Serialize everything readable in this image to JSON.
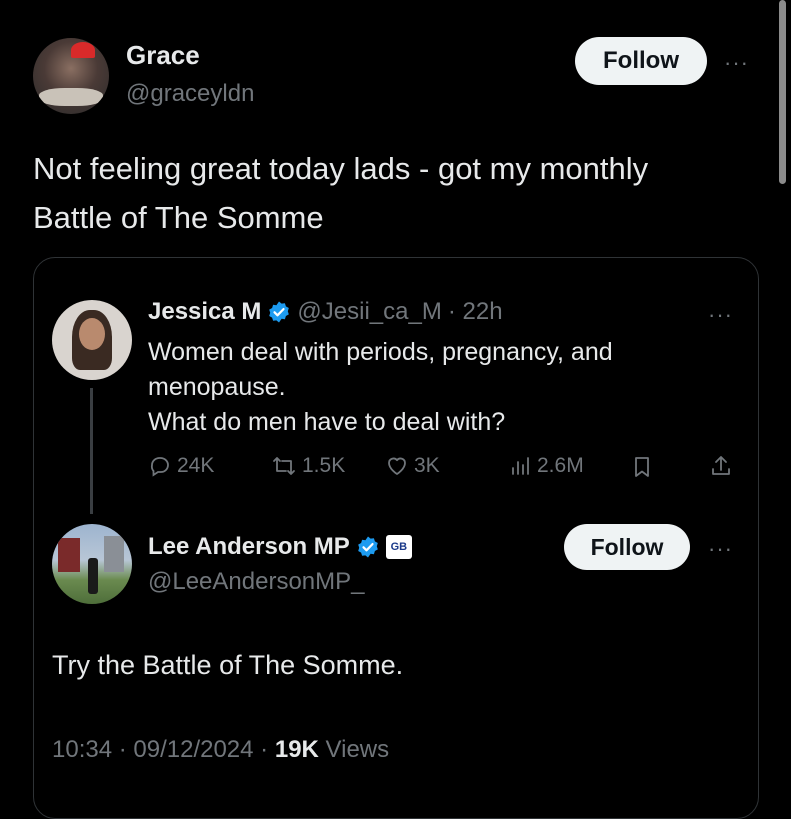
{
  "outer_tweet": {
    "display_name": "Grace",
    "handle": "@graceyldn",
    "follow_label": "Follow",
    "more_label": "···",
    "text_line1": "Not feeling great today lads - got my monthly",
    "text_line2": "Battle of The Somme"
  },
  "quoted": {
    "first": {
      "display_name": "Jessica M",
      "handle": "@Jesii_ca_M",
      "time": "· 22h",
      "line1": "Women deal with periods, pregnancy, and",
      "line2": "menopause.",
      "line3": "What do men have to deal with?",
      "more_label": "···",
      "stats": {
        "replies": "24K",
        "reposts": "1.5K",
        "likes": "3K",
        "views": "2.6M"
      }
    },
    "reply": {
      "display_name": "Lee Anderson MP",
      "handle": "@LeeAndersonMP_",
      "badge": "GB",
      "follow_label": "Follow",
      "more_label": "···",
      "text": "Try the Battle of The Somme.",
      "meta_time": "10:34 · 09/12/2024 · ",
      "meta_views_count": "19K",
      "meta_views_label": " Views"
    }
  },
  "colors": {
    "background": "#000000",
    "text": "#e7e9ea",
    "muted": "#71767b",
    "verified": "#1d9bf0",
    "border": "#2f3336"
  }
}
